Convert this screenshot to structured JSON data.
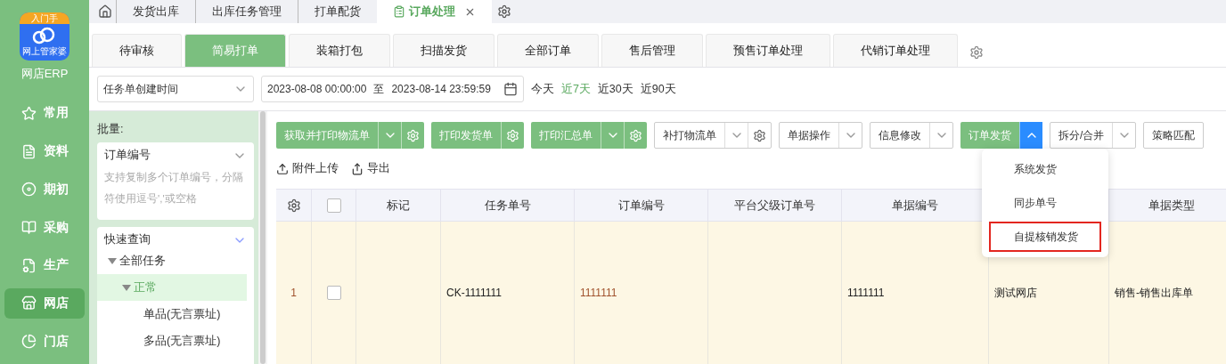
{
  "sidebar": {
    "logo": {
      "badge": "入门手",
      "caption": "网上管家婆"
    },
    "app_name": "网店ERP",
    "items": [
      {
        "label": "常用",
        "selected": false
      },
      {
        "label": "资料",
        "selected": false
      },
      {
        "label": "期初",
        "selected": false
      },
      {
        "label": "采购",
        "selected": false
      },
      {
        "label": "生产",
        "selected": false
      },
      {
        "label": "网店",
        "selected": true
      },
      {
        "label": "门店",
        "selected": false
      }
    ]
  },
  "top_tabs": [
    {
      "label": "发货出库",
      "selected": false
    },
    {
      "label": "出库任务管理",
      "selected": false
    },
    {
      "label": "打单配货",
      "selected": false
    },
    {
      "label": "订单处理",
      "selected": true
    }
  ],
  "sub_tabs": [
    {
      "label": "待审核",
      "selected": false
    },
    {
      "label": "简易打单",
      "selected": true
    },
    {
      "label": "装箱打包",
      "selected": false
    },
    {
      "label": "扫描发货",
      "selected": false
    },
    {
      "label": "全部订单",
      "selected": false
    },
    {
      "label": "售后管理",
      "selected": false
    },
    {
      "label": "预售订单处理",
      "selected": false
    },
    {
      "label": "代销订单处理",
      "selected": false
    }
  ],
  "filter": {
    "date_type": "任务单创建时间",
    "start": "2023-08-08 00:00:00",
    "separator": "至",
    "end": "2023-08-14 23:59:59",
    "quick_ranges": [
      {
        "label": "今天",
        "selected": false
      },
      {
        "label": "近7天",
        "selected": true
      },
      {
        "label": "近30天",
        "selected": false
      },
      {
        "label": "近90天",
        "selected": false
      }
    ]
  },
  "left_panel": {
    "batch_label": "批量:",
    "batch_field": "订单编号",
    "batch_placeholder": "支持复制多个订单编号，分隔符使用逗号','或空格",
    "quick_query": "快速查询",
    "tree": [
      {
        "label": "全部任务",
        "expanded": true,
        "selected": false,
        "children": [
          {
            "label": "正常",
            "expanded": true,
            "selected": true,
            "children": [
              {
                "label": "单品(无言票址)",
                "selected": false
              },
              {
                "label": "多品(无言票址)",
                "selected": false
              }
            ]
          }
        ]
      }
    ]
  },
  "toolbar": [
    {
      "label": "获取并打印物流单",
      "kind": "green",
      "expanded": false,
      "gear": true
    },
    {
      "label": "打印发货单",
      "kind": "green",
      "gear": true
    },
    {
      "label": "打印汇总单",
      "kind": "green",
      "expanded": false,
      "gear": true
    },
    {
      "label": "补打物流单",
      "kind": "outline",
      "expanded": false,
      "gear": true
    },
    {
      "label": "单据操作",
      "kind": "outline",
      "expanded": false
    },
    {
      "label": "信息修改",
      "kind": "outline",
      "expanded": false
    },
    {
      "label": "订单发货",
      "kind": "green",
      "expanded": true
    },
    {
      "label": "拆分/合并",
      "kind": "outline",
      "expanded": false
    },
    {
      "label": "策略匹配",
      "kind": "outline"
    }
  ],
  "dropdown": [
    {
      "label": "系统发货",
      "highlighted": false
    },
    {
      "label": "同步单号",
      "highlighted": false
    },
    {
      "label": "自提核销发货",
      "highlighted": true
    }
  ],
  "actions": [
    "附件上传",
    "导出"
  ],
  "table": {
    "columns": [
      {
        "kind": "settings"
      },
      {
        "kind": "checkbox",
        "checked": false
      },
      {
        "label": "标记"
      },
      {
        "label": "任务单号"
      },
      {
        "label": "订单编号"
      },
      {
        "label": "平台父级订单号"
      },
      {
        "label": "单据编号"
      },
      {},
      {
        "label": "单据类型"
      }
    ],
    "rows": [
      {
        "checked": false,
        "cells": [
          "1",
          "",
          "",
          "CK-1111111",
          "1111111",
          "",
          "1111111",
          "测试网店",
          "销售-销售出库单"
        ]
      }
    ]
  }
}
